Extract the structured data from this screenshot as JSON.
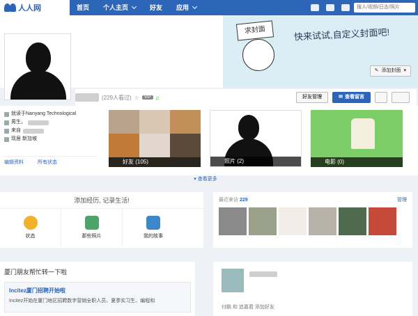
{
  "nav": {
    "logo": "人人网",
    "items": [
      "首页",
      "个人主页",
      "好友",
      "应用"
    ],
    "search_placeholder": "搜人/视频/日志/照片"
  },
  "cover": {
    "sign_text": "求封面",
    "tagline": "快来试试,自定义封面吧!",
    "add_cover_label": "添加封面"
  },
  "profile": {
    "views_text": "(229人看过)",
    "vip_label": "VIP",
    "friend_manage_label": "好友管理",
    "message_label": "查看留言"
  },
  "info": {
    "school_text": "就读于Nanyang Technological",
    "gender_text": "男生，",
    "from_text": "来自",
    "location_text": "现居 新加坡",
    "edit_label": "编辑资料",
    "status_label": "所有状态"
  },
  "tiles": {
    "friends": "好友 (105)",
    "photos": "照片 (2)",
    "movies": "电影 (0)"
  },
  "see_more": "查看更多",
  "record": {
    "title": "添加经历, 记录生活!",
    "actions": [
      "状态",
      "那些照片",
      "我的故事"
    ]
  },
  "visits": {
    "label": "最近来访",
    "count": "229",
    "manage": "管理"
  },
  "feed_left": {
    "heading": "厦门朋友帮忙转一下啦",
    "post_title": "Incitez厦门招聘开始啦",
    "post_body": "Incitez开始在厦门地区招聘数字营销全职人员、夏季实习生、编程和"
  },
  "feed_right": {
    "line": "付鹏 和 追嘉君 添加好友"
  }
}
